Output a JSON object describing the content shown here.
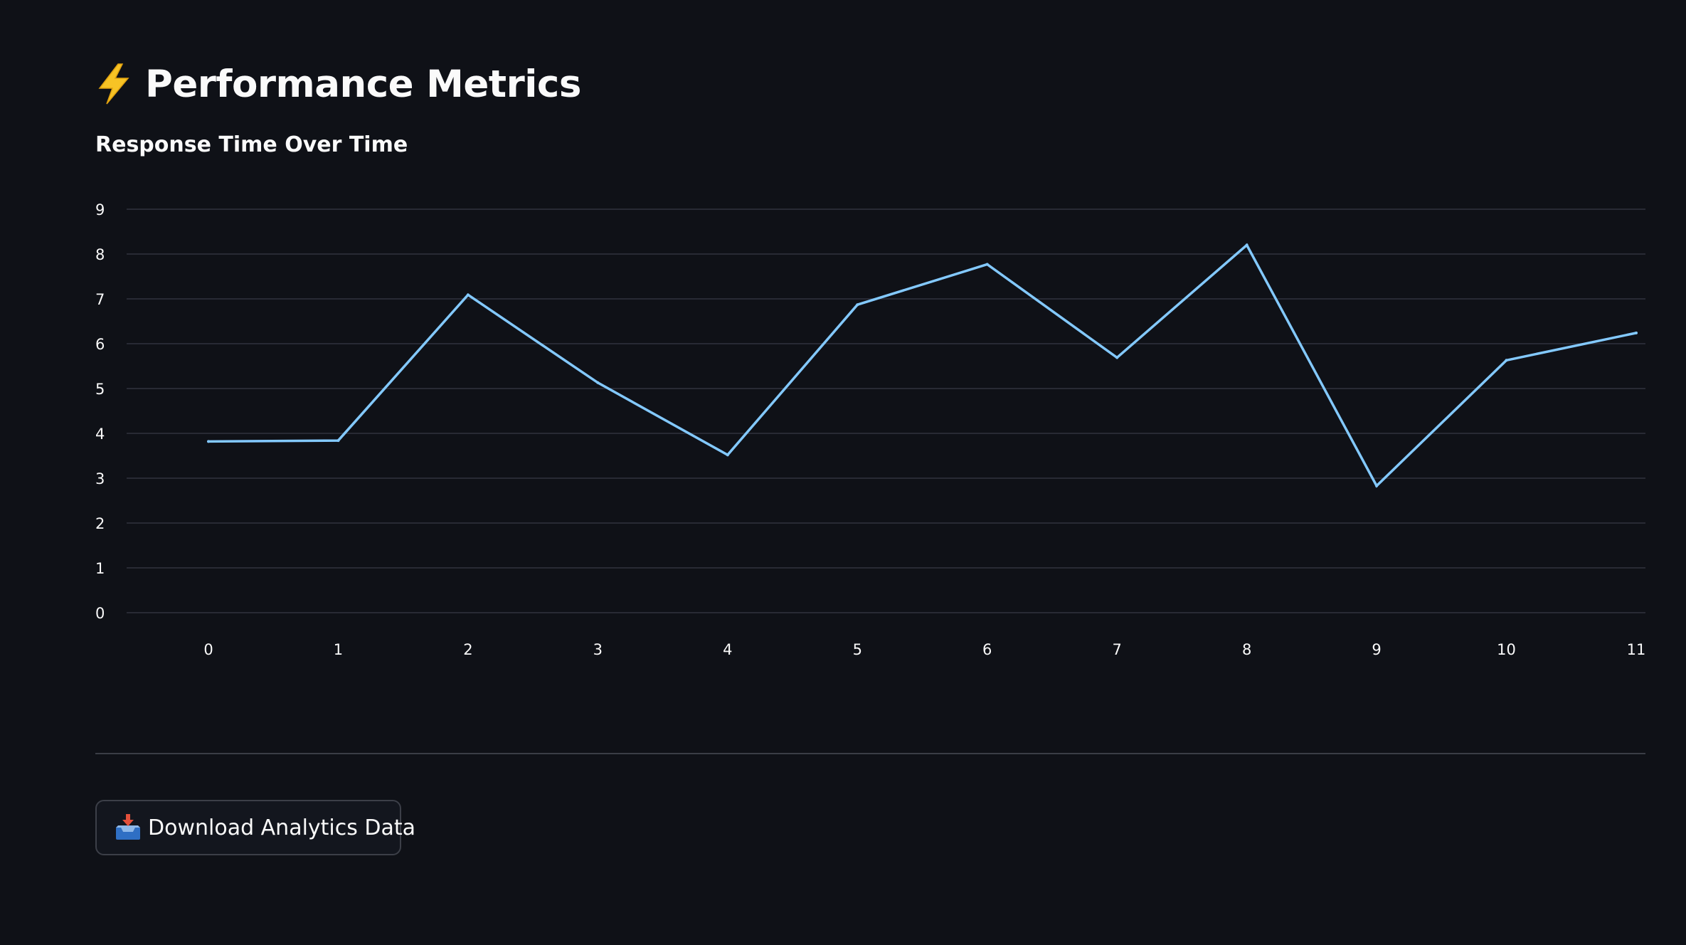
{
  "page": {
    "title": "Performance Metrics",
    "title_icon": "lightning-bolt-icon"
  },
  "section": {
    "title": "Response Time Over Time"
  },
  "chart_data": {
    "type": "line",
    "title": "Response Time Over Time",
    "xlabel": "",
    "ylabel": "",
    "x": [
      0,
      1,
      2,
      3,
      4,
      5,
      6,
      7,
      8,
      9,
      10,
      11
    ],
    "series": [
      {
        "values": [
          3.82,
          3.84,
          7.09,
          5.13,
          3.52,
          6.87,
          7.77,
          5.69,
          8.2,
          2.83,
          5.63,
          6.24
        ],
        "color": "#83c9ff"
      }
    ],
    "yticks": [
      0,
      1,
      2,
      3,
      4,
      5,
      6,
      7,
      8,
      9
    ],
    "xticks": [
      0,
      1,
      2,
      3,
      4,
      5,
      6,
      7,
      8,
      9,
      10,
      11
    ],
    "ylim": [
      0,
      9
    ],
    "xlim": [
      0,
      11
    ],
    "grid": true,
    "grid_axis": "y"
  },
  "download": {
    "label": "Download Analytics Data",
    "icon": "inbox-tray-icon"
  },
  "colors": {
    "background": "#0f1117",
    "text": "#fafafa",
    "line": "#83c9ff",
    "grid": "#31333f"
  }
}
